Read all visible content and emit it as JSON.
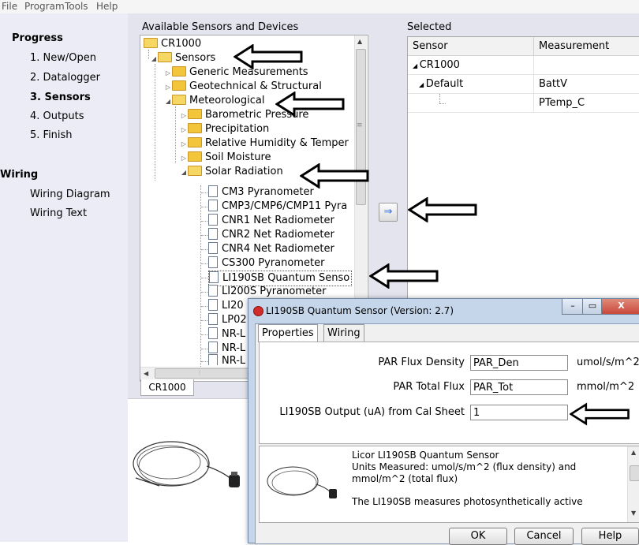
{
  "menu": [
    "File",
    "Program",
    "Tools",
    "Help"
  ],
  "progress": {
    "heading": "Progress",
    "steps": [
      "1. New/Open",
      "2. Datalogger",
      "3. Sensors",
      "4. Outputs",
      "5. Finish"
    ],
    "active_step": "3. Sensors"
  },
  "wiring": {
    "heading": "Wiring",
    "items": [
      "Wiring Diagram",
      "Wiring Text"
    ]
  },
  "available": {
    "label": "Available Sensors and Devices",
    "tree": {
      "root": "CR1000",
      "sensors": "Sensors",
      "generic": "Generic Measurements",
      "geotech": "Geotechnical & Structural",
      "meteo": "Meteorological",
      "baro": "Barometric Pressure",
      "precip": "Precipitation",
      "rh": "Relative Humidity & Temper",
      "soil": "Soil Moisture",
      "solar": "Solar Radiation",
      "solar_items": [
        "CM3 Pyranometer",
        "CMP3/CMP6/CMP11 Pyra",
        "CNR1 Net Radiometer",
        "CNR2 Net Radiometer",
        "CNR4 Net Radiometer",
        "CS300 Pyranometer",
        "LI190SB Quantum Senso",
        "LI200S Pyranometer",
        "LI20",
        "LP02",
        "NR-L",
        "NR-L",
        "NR-L"
      ]
    },
    "tab": "CR1000"
  },
  "selected": {
    "label": "Selected",
    "col_sensor": "Sensor",
    "col_measurement": "Measurement",
    "row_root": "CR1000",
    "row_default": "Default",
    "measurements": [
      "BattV",
      "PTemp_C"
    ]
  },
  "move_button_glyph": "⇒",
  "dialog": {
    "title": "LI190SB Quantum Sensor (Version: 2.7)",
    "tabs": [
      "Properties",
      "Wiring"
    ],
    "fields": [
      {
        "label": "PAR Flux Density",
        "value": "PAR_Den",
        "unit": "umol/s/m^2"
      },
      {
        "label": "PAR Total Flux",
        "value": "PAR_Tot",
        "unit": "mmol/m^2"
      },
      {
        "label": "LI190SB Output (uA) from Cal Sheet",
        "value": "1",
        "unit": ""
      }
    ],
    "description": {
      "line1": "Licor LI190SB  Quantum Sensor",
      "line2": "Units Measured: umol/s/m^2 (flux density) and",
      "line3": "mmol/m^2 (total flux)",
      "line4": "The LI190SB measures photosynthetically active"
    },
    "buttons": {
      "ok": "OK",
      "cancel": "Cancel",
      "help": "Help"
    },
    "window_buttons": {
      "minimize": "–",
      "maximize": "▭",
      "close": "X"
    }
  },
  "colors": {
    "nav_bg": "#ececf6",
    "main_bg": "#e4e4ef",
    "dialog_frame": "#c5d6ea",
    "close_button": "#c8473b"
  }
}
